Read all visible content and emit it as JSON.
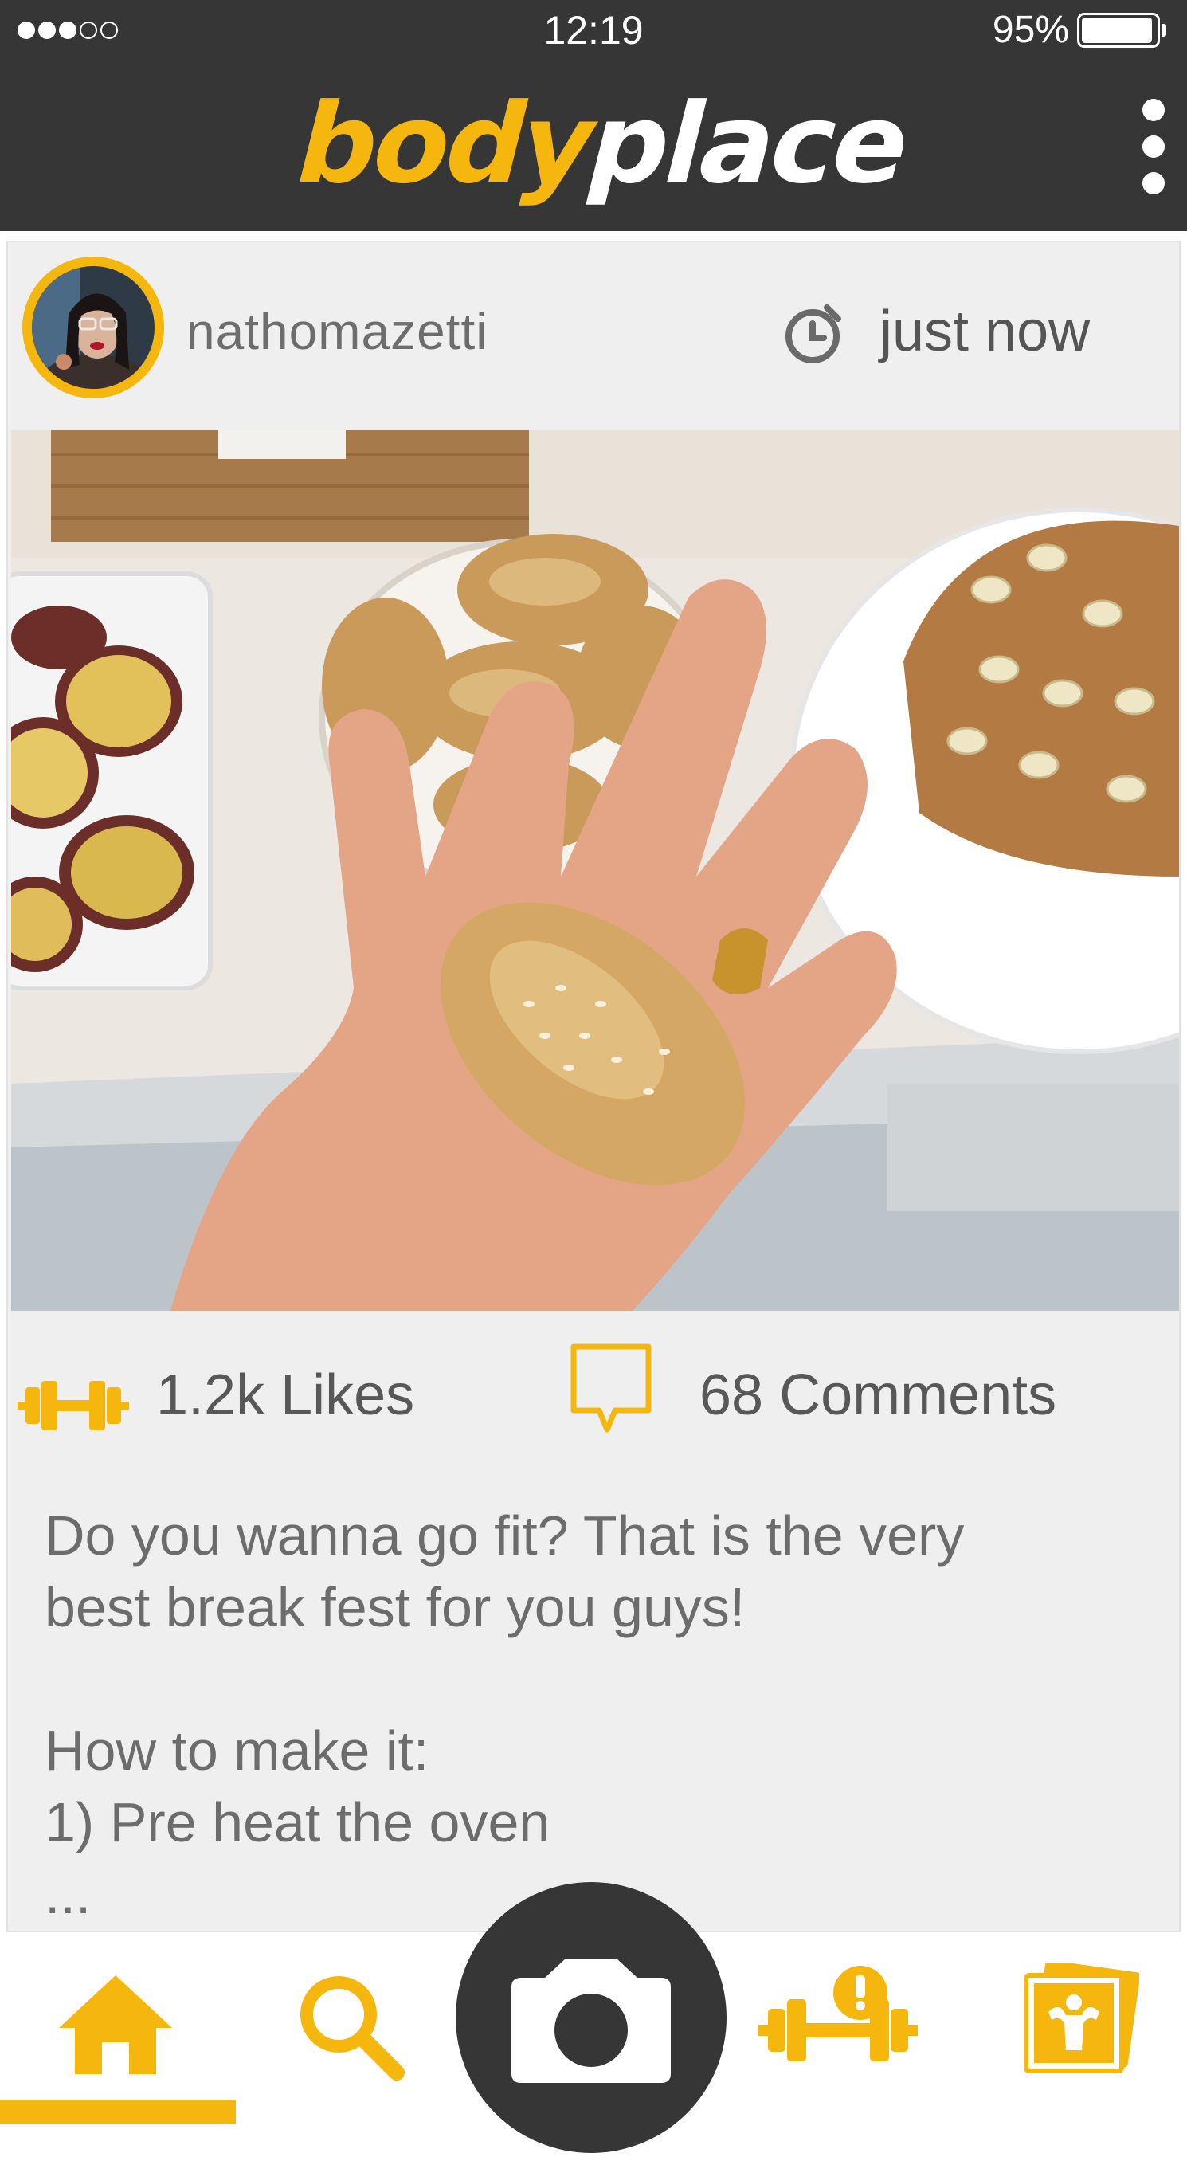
{
  "status_bar": {
    "signal_dots_filled": 3,
    "signal_dots_total": 5,
    "time": "12:19",
    "battery_percent": "95%",
    "battery_level": 0.95
  },
  "header": {
    "logo_part1": "body",
    "logo_part2": "place",
    "menu_icon": "more-vertical-icon",
    "background_color": "#363636",
    "brand_color": "#f5b70e"
  },
  "post": {
    "username": "nathomazetti",
    "time_icon": "clock-icon",
    "time": "just now",
    "photo_icon": "food-photo",
    "likes_icon": "dumbbell-icon",
    "likes": "1.2k Likes",
    "comments_icon": "comment-bubble-icon",
    "comments": "68 Comments",
    "caption": "Do you wanna go fit? That is the very\nbest break fest for you guys!\n\nHow to make it:\n1) Pre heat the oven\n..."
  },
  "bottom_nav": {
    "items": [
      {
        "icon": "home-icon",
        "active": true
      },
      {
        "icon": "search-icon",
        "active": false
      },
      {
        "icon": "camera-icon",
        "active": false
      },
      {
        "icon": "dumbbell-alert-icon",
        "active": false
      },
      {
        "icon": "fitness-gallery-icon",
        "active": false
      }
    ]
  }
}
